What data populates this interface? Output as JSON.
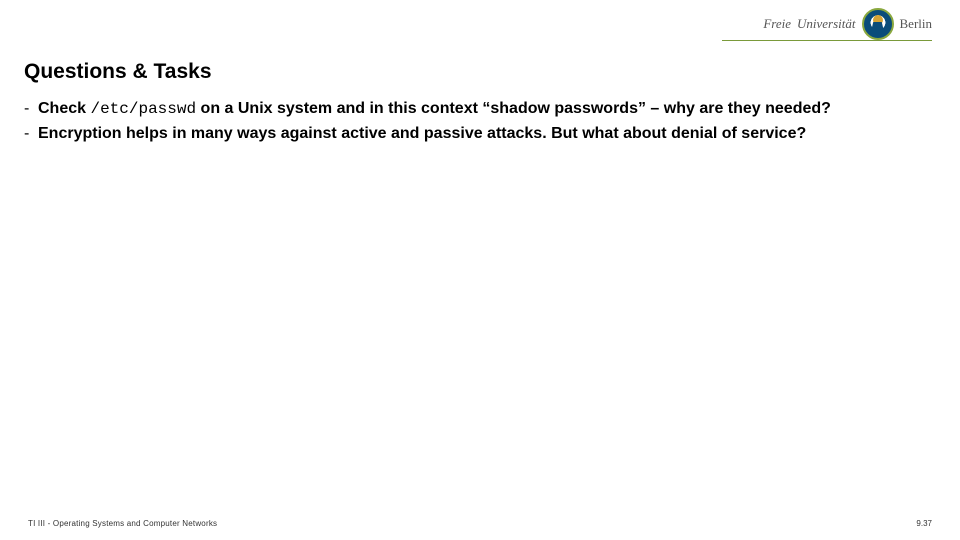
{
  "brand": {
    "word1": "Freie",
    "word2": "Universität",
    "word3": "Berlin"
  },
  "title": "Questions & Tasks",
  "bullets": [
    {
      "parts": {
        "lead": "Check ",
        "code": "/etc/passwd",
        "tail": " on a Unix system and in this context “shadow passwords” – why are they needed?"
      }
    },
    {
      "parts": {
        "lead": "Encryption helps in many ways against active and passive attacks. But what about denial of service?",
        "code": "",
        "tail": ""
      }
    }
  ],
  "footer": {
    "left": "TI III - Operating Systems and Computer Networks",
    "right": "9.37"
  }
}
